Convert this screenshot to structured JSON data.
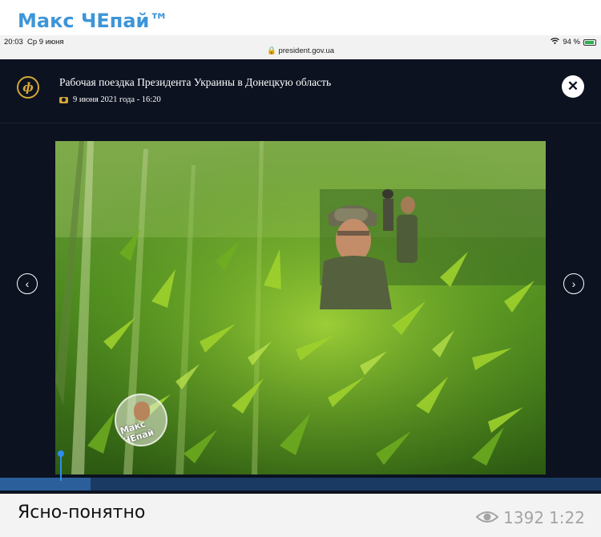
{
  "channel": {
    "title": "Макс ЧЕпай™"
  },
  "statusbar": {
    "time": "20:03",
    "date": "Ср 9 июня",
    "battery": "94 %",
    "battery_level": 0.94,
    "url": "president.gov.ua"
  },
  "gallery": {
    "title": "Рабочая поездка Президента Украины в Донецкую область",
    "date": "9 июня 2021 года - 16:20",
    "icons": {
      "logo": "president-emblem-icon",
      "camera": "camera-icon",
      "close": "close-icon",
      "prev": "chevron-left-icon",
      "next": "chevron-right-icon"
    },
    "watermark": "Макс ЧЕпай",
    "progress": 0.15
  },
  "post": {
    "caption": "Ясно-понятно",
    "views": "1392",
    "time": "1:22"
  },
  "colors": {
    "brand": "#3e95d8",
    "viewer_bg": "#0c1220",
    "accent_gold": "#d4a636"
  }
}
